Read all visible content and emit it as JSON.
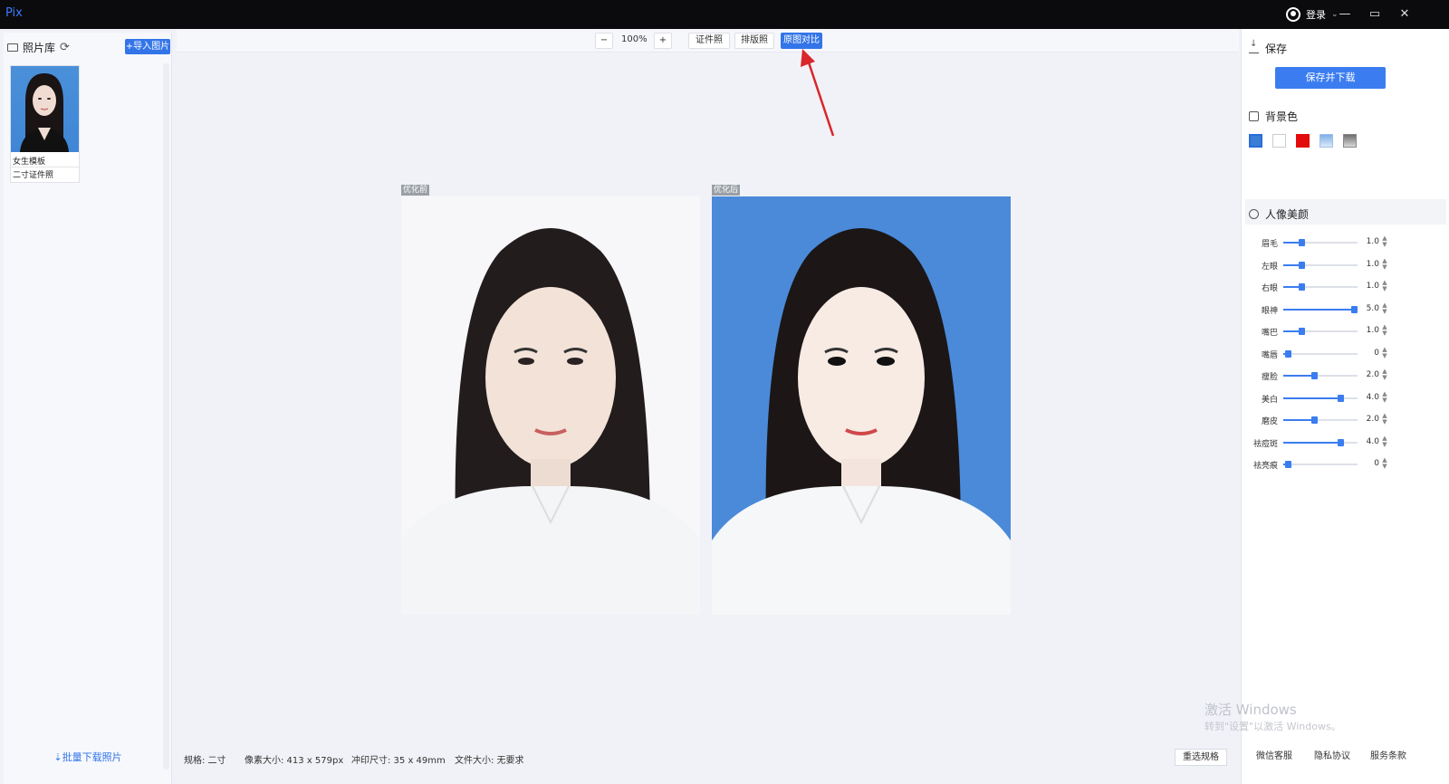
{
  "titlebar": {
    "app_name": "Pix",
    "login_label": "登录"
  },
  "sidebar": {
    "title": "照片库",
    "import_label": "+导入图片",
    "thumb": {
      "name": "女生模板",
      "subtitle": "二寸证件照"
    },
    "batch_download_label": "⇣批量下载照片"
  },
  "toolbar": {
    "zoom_out": "−",
    "zoom_value": "100%",
    "zoom_in": "+",
    "tabs": [
      {
        "label": "证件照",
        "active": false
      },
      {
        "label": "排版照",
        "active": false
      },
      {
        "label": "原图对比",
        "active": true
      }
    ]
  },
  "canvas": {
    "before_label": "优化前",
    "after_label": "优化后"
  },
  "status": {
    "spec": "规格:  二寸",
    "pixel": "像素大小:  413 x 579px",
    "print": "冲印尺寸:  35 x 49mm",
    "filesize": "文件大小:  无要求",
    "reselect_label": "重选规格"
  },
  "rpanel": {
    "save_title": "保存",
    "save_button": "保存并下载",
    "bg_title": "背景色",
    "bg_colors": [
      "#3a7fd5",
      "#ffffff",
      "#e30b0b",
      "#7fb0e8",
      "#8a8a8a"
    ],
    "beauty_title": "人像美颜",
    "sliders": [
      {
        "label": "眉毛",
        "value": "1.0",
        "level": 0.2
      },
      {
        "label": "左眼",
        "value": "1.0",
        "level": 0.2
      },
      {
        "label": "右眼",
        "value": "1.0",
        "level": 0.2
      },
      {
        "label": "眼神",
        "value": "5.0",
        "level": 1.0
      },
      {
        "label": "嘴巴",
        "value": "1.0",
        "level": 0.2
      },
      {
        "label": "嘴唇",
        "value": "0",
        "level": 0.0
      },
      {
        "label": "瘦脸",
        "value": "2.0",
        "level": 0.4
      },
      {
        "label": "美白",
        "value": "4.0",
        "level": 0.8
      },
      {
        "label": "磨皮",
        "value": "2.0",
        "level": 0.4
      },
      {
        "label": "祛痘斑",
        "value": "4.0",
        "level": 0.8
      },
      {
        "label": "祛亮痕",
        "value": "0",
        "level": 0.0
      }
    ],
    "footer_links": [
      "微信客服",
      "隐私协议",
      "服务条款"
    ]
  },
  "watermark": {
    "line1": "激活 Windows",
    "line2": "转到\"设置\"以激活 Windows。"
  }
}
